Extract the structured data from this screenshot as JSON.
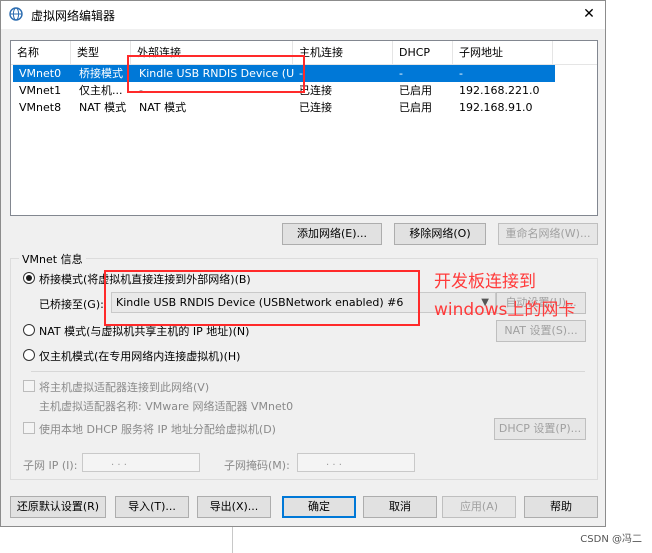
{
  "window": {
    "title": "虚拟网络编辑器",
    "close_label": "✕"
  },
  "table": {
    "headers": [
      "名称",
      "类型",
      "外部连接",
      "主机连接",
      "DHCP",
      "子网地址"
    ],
    "rows": [
      [
        "VMnet0",
        "桥接模式",
        "Kindle USB RNDIS Device (U...",
        "-",
        "-",
        "-"
      ],
      [
        "VMnet1",
        "仅主机...",
        "-",
        "已连接",
        "已启用",
        "192.168.221.0"
      ],
      [
        "VMnet8",
        "NAT 模式",
        "NAT 模式",
        "已连接",
        "已启用",
        "192.168.91.0"
      ]
    ]
  },
  "net_buttons": {
    "add": "添加网络(E)...",
    "remove": "移除网络(O)",
    "rename": "重命名网络(W)..."
  },
  "vmnet_info": {
    "group_label": "VMnet 信息",
    "bridged_label": "桥接模式(将虚拟机直接连接到外部网络)(B)",
    "bridged_to_label": "已桥接至(G):",
    "bridged_to_value": "Kindle USB RNDIS Device (USBNetwork enabled) #6",
    "auto_settings": "自动设置(U)...",
    "nat_label": "NAT 模式(与虚拟机共享主机的 IP 地址)(N)",
    "nat_settings": "NAT 设置(S)...",
    "hostonly_label": "仅主机模式(在专用网络内连接虚拟机)(H)",
    "connect_adapter_label": "将主机虚拟适配器连接到此网络(V)",
    "adapter_name_label": "主机虚拟适配器名称: VMware 网络适配器 VMnet0",
    "dhcp_label": "使用本地 DHCP 服务将 IP 地址分配给虚拟机(D)",
    "dhcp_settings": "DHCP 设置(P)...",
    "subnet_ip_label": "子网 IP (I):",
    "subnet_mask_label": "子网掩码(M):",
    "ip_placeholder": ".        .        ."
  },
  "footer_buttons": {
    "restore": "还原默认设置(R)",
    "import": "导入(T)...",
    "export": "导出(X)...",
    "ok": "确定",
    "cancel": "取消",
    "apply": "应用(A)",
    "help": "帮助"
  },
  "annotation": {
    "line1": "开发板连接到",
    "line2": "windows上的网卡"
  },
  "watermark": "CSDN @冯二",
  "colors": {
    "selection": "#0078d7",
    "annotation": "#ff2a2a"
  }
}
